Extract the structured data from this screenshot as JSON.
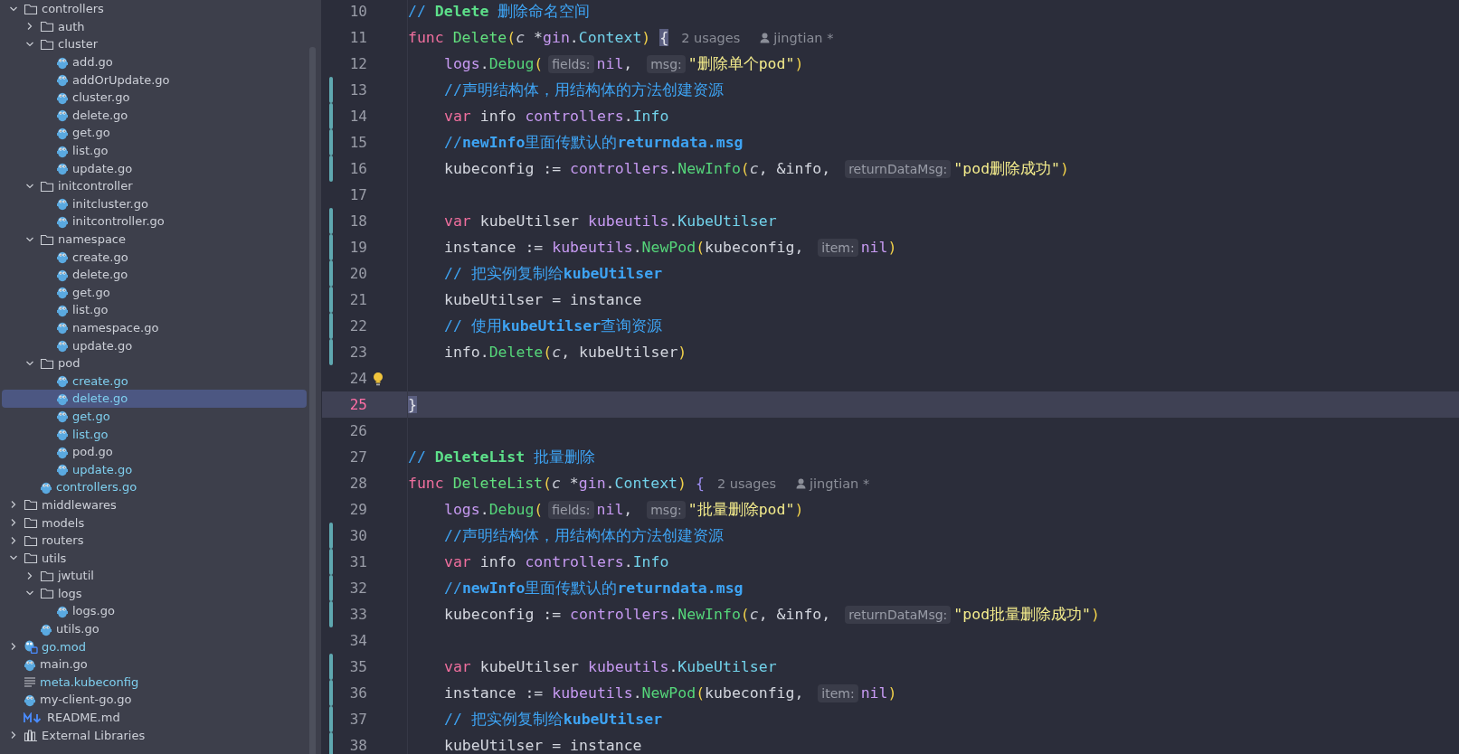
{
  "project_tree": [
    {
      "label": "controllers",
      "kind": "folder",
      "expanded": true,
      "children": [
        {
          "label": "auth",
          "kind": "folder",
          "expanded": false
        },
        {
          "label": "cluster",
          "kind": "folder",
          "expanded": true,
          "children": [
            {
              "label": "add.go",
              "kind": "go",
              "modified": false,
              "selected": false
            },
            {
              "label": "addOrUpdate.go",
              "kind": "go",
              "modified": false,
              "selected": false
            },
            {
              "label": "cluster.go",
              "kind": "go",
              "modified": false,
              "selected": false
            },
            {
              "label": "delete.go",
              "kind": "go",
              "modified": false,
              "selected": false
            },
            {
              "label": "get.go",
              "kind": "go",
              "modified": false,
              "selected": false
            },
            {
              "label": "list.go",
              "kind": "go",
              "modified": false,
              "selected": false
            },
            {
              "label": "update.go",
              "kind": "go",
              "modified": false,
              "selected": false
            }
          ]
        },
        {
          "label": "initcontroller",
          "kind": "folder",
          "expanded": true,
          "children": [
            {
              "label": "initcluster.go",
              "kind": "go",
              "modified": false,
              "selected": false
            },
            {
              "label": "initcontroller.go",
              "kind": "go",
              "modified": false,
              "selected": false
            }
          ]
        },
        {
          "label": "namespace",
          "kind": "folder",
          "expanded": true,
          "children": [
            {
              "label": "create.go",
              "kind": "go",
              "modified": false,
              "selected": false
            },
            {
              "label": "delete.go",
              "kind": "go",
              "modified": false,
              "selected": false
            },
            {
              "label": "get.go",
              "kind": "go",
              "modified": false,
              "selected": false
            },
            {
              "label": "list.go",
              "kind": "go",
              "modified": false,
              "selected": false
            },
            {
              "label": "namespace.go",
              "kind": "go",
              "modified": false,
              "selected": false
            },
            {
              "label": "update.go",
              "kind": "go",
              "modified": false,
              "selected": false
            }
          ]
        },
        {
          "label": "pod",
          "kind": "folder",
          "expanded": true,
          "children": [
            {
              "label": "create.go",
              "kind": "go",
              "modified": true,
              "selected": false
            },
            {
              "label": "delete.go",
              "kind": "go",
              "modified": true,
              "selected": true
            },
            {
              "label": "get.go",
              "kind": "go",
              "modified": true,
              "selected": false
            },
            {
              "label": "list.go",
              "kind": "go",
              "modified": true,
              "selected": false
            },
            {
              "label": "pod.go",
              "kind": "go",
              "modified": false,
              "selected": false
            },
            {
              "label": "update.go",
              "kind": "go",
              "modified": true,
              "selected": false
            }
          ]
        },
        {
          "label": "controllers.go",
          "kind": "go",
          "modified": true,
          "selected": false
        }
      ]
    },
    {
      "label": "middlewares",
      "kind": "folder",
      "expanded": false
    },
    {
      "label": "models",
      "kind": "folder",
      "expanded": false
    },
    {
      "label": "routers",
      "kind": "folder",
      "expanded": false
    },
    {
      "label": "utils",
      "kind": "folder",
      "expanded": true,
      "children": [
        {
          "label": "jwtutil",
          "kind": "folder",
          "expanded": false
        },
        {
          "label": "logs",
          "kind": "folder",
          "expanded": true,
          "children": [
            {
              "label": "logs.go",
              "kind": "go",
              "modified": false,
              "selected": false
            }
          ]
        },
        {
          "label": "utils.go",
          "kind": "go",
          "modified": false,
          "selected": false
        }
      ]
    },
    {
      "label": "go.mod",
      "kind": "module",
      "expanded": false,
      "modified": true,
      "selected": false
    },
    {
      "label": "main.go",
      "kind": "go",
      "modified": false,
      "selected": false
    },
    {
      "label": "meta.kubeconfig",
      "kind": "text",
      "modified": true,
      "selected": false
    },
    {
      "label": "my-client-go.go",
      "kind": "go",
      "modified": false,
      "selected": false
    },
    {
      "label": "README.md",
      "kind": "markdown",
      "modified": false,
      "selected": false
    },
    {
      "label": "External Libraries",
      "kind": "library",
      "expanded": false
    }
  ],
  "editor": {
    "lines": [
      {
        "number": "10",
        "changed": false,
        "current": false,
        "indented": false,
        "bulb": false,
        "tokens": [
          {
            "text": "// ",
            "kind": "cmt"
          },
          {
            "text": "Delete",
            "kind": "doc"
          },
          {
            "text": " 删除命名空间",
            "kind": "cmt"
          }
        ]
      },
      {
        "number": "11",
        "changed": false,
        "current": false,
        "indented": false,
        "bulb": false,
        "tokens": [
          {
            "text": "func ",
            "kind": "kw"
          },
          {
            "text": "Delete",
            "kind": "fn"
          },
          {
            "text": "(",
            "kind": "paren"
          },
          {
            "text": "c",
            "kind": "param"
          },
          {
            "text": " *",
            "kind": "plain"
          },
          {
            "text": "gin",
            "kind": "pkg"
          },
          {
            "text": ".",
            "kind": "plain"
          },
          {
            "text": "Context",
            "kind": "type"
          },
          {
            "text": ") ",
            "kind": "paren"
          },
          {
            "text": "{",
            "kind": "match"
          },
          {
            "text": "2 usages",
            "kind": "usages"
          },
          {
            "text": "jingtian *",
            "kind": "author"
          }
        ]
      },
      {
        "number": "12",
        "changed": false,
        "current": false,
        "indented": true,
        "bulb": false,
        "tokens": [
          {
            "text": "logs",
            "kind": "pkg"
          },
          {
            "text": ".",
            "kind": "plain"
          },
          {
            "text": "Debug",
            "kind": "call"
          },
          {
            "text": "(",
            "kind": "paren"
          },
          {
            "text": "fields:",
            "kind": "hint"
          },
          {
            "text": "nil",
            "kind": "nil"
          },
          {
            "text": ", ",
            "kind": "plain"
          },
          {
            "text": "msg:",
            "kind": "hint"
          },
          {
            "text": "\"删除单个pod\"",
            "kind": "str"
          },
          {
            "text": ")",
            "kind": "paren"
          }
        ]
      },
      {
        "number": "13",
        "changed": true,
        "current": false,
        "indented": true,
        "bulb": false,
        "tokens": [
          {
            "text": "//声明结构体，用结构体的方法创建资源",
            "kind": "cmt"
          }
        ]
      },
      {
        "number": "14",
        "changed": true,
        "current": false,
        "indented": true,
        "bulb": false,
        "tokens": [
          {
            "text": "var ",
            "kind": "kw"
          },
          {
            "text": "info ",
            "kind": "plain"
          },
          {
            "text": "controllers",
            "kind": "pkg"
          },
          {
            "text": ".",
            "kind": "plain"
          },
          {
            "text": "Info",
            "kind": "type"
          }
        ]
      },
      {
        "number": "15",
        "changed": true,
        "current": false,
        "indented": true,
        "bulb": false,
        "tokens": [
          {
            "text": "//",
            "kind": "cmt"
          },
          {
            "text": "newInfo",
            "kind": "cmtb"
          },
          {
            "text": "里面传默认的",
            "kind": "cmt"
          },
          {
            "text": "returndata.msg",
            "kind": "cmtb"
          }
        ]
      },
      {
        "number": "16",
        "changed": true,
        "current": false,
        "indented": true,
        "bulb": false,
        "tokens": [
          {
            "text": "kubeconfig := ",
            "kind": "plain"
          },
          {
            "text": "controllers",
            "kind": "pkg"
          },
          {
            "text": ".",
            "kind": "plain"
          },
          {
            "text": "NewInfo",
            "kind": "call"
          },
          {
            "text": "(",
            "kind": "paren"
          },
          {
            "text": "c",
            "kind": "param"
          },
          {
            "text": ", &info, ",
            "kind": "plain"
          },
          {
            "text": "returnDataMsg:",
            "kind": "hint"
          },
          {
            "text": "\"pod删除成功\"",
            "kind": "str"
          },
          {
            "text": ")",
            "kind": "paren"
          }
        ]
      },
      {
        "number": "17",
        "changed": false,
        "current": false,
        "indented": false,
        "bulb": false
      },
      {
        "number": "18",
        "changed": true,
        "current": false,
        "indented": true,
        "bulb": false,
        "tokens": [
          {
            "text": "var ",
            "kind": "kw"
          },
          {
            "text": "kubeUtilser ",
            "kind": "plain"
          },
          {
            "text": "kubeutils",
            "kind": "pkg"
          },
          {
            "text": ".",
            "kind": "plain"
          },
          {
            "text": "KubeUtilser",
            "kind": "type"
          }
        ]
      },
      {
        "number": "19",
        "changed": true,
        "current": false,
        "indented": true,
        "bulb": false,
        "tokens": [
          {
            "text": "instance := ",
            "kind": "plain"
          },
          {
            "text": "kubeutils",
            "kind": "pkg"
          },
          {
            "text": ".",
            "kind": "plain"
          },
          {
            "text": "NewPod",
            "kind": "call"
          },
          {
            "text": "(",
            "kind": "paren"
          },
          {
            "text": "kubeconfig, ",
            "kind": "plain"
          },
          {
            "text": "item:",
            "kind": "hint"
          },
          {
            "text": "nil",
            "kind": "nil"
          },
          {
            "text": ")",
            "kind": "paren"
          }
        ]
      },
      {
        "number": "20",
        "changed": true,
        "current": false,
        "indented": true,
        "bulb": false,
        "tokens": [
          {
            "text": "// 把实例复制给",
            "kind": "cmt"
          },
          {
            "text": "kubeUtilser",
            "kind": "cmtb"
          }
        ]
      },
      {
        "number": "21",
        "changed": true,
        "current": false,
        "indented": true,
        "bulb": false,
        "tokens": [
          {
            "text": "kubeUtilser = instance",
            "kind": "plain"
          }
        ]
      },
      {
        "number": "22",
        "changed": true,
        "current": false,
        "indented": true,
        "bulb": false,
        "tokens": [
          {
            "text": "// 使用",
            "kind": "cmt"
          },
          {
            "text": "kubeUtilser",
            "kind": "cmtb"
          },
          {
            "text": "查询资源",
            "kind": "cmt"
          }
        ]
      },
      {
        "number": "23",
        "changed": true,
        "current": false,
        "indented": true,
        "bulb": false,
        "tokens": [
          {
            "text": "info",
            "kind": "plain"
          },
          {
            "text": ".",
            "kind": "plain"
          },
          {
            "text": "Delete",
            "kind": "call"
          },
          {
            "text": "(",
            "kind": "paren"
          },
          {
            "text": "c",
            "kind": "param"
          },
          {
            "text": ", kubeUtilser",
            "kind": "plain"
          },
          {
            "text": ")",
            "kind": "paren"
          }
        ]
      },
      {
        "number": "24",
        "changed": false,
        "current": false,
        "indented": false,
        "bulb": true
      },
      {
        "number": "25",
        "changed": false,
        "current": true,
        "indented": false,
        "bulb": false,
        "tokens": [
          {
            "text": "}",
            "kind": "match"
          }
        ]
      },
      {
        "number": "26",
        "changed": false,
        "current": false,
        "indented": false,
        "bulb": false
      },
      {
        "number": "27",
        "changed": false,
        "current": false,
        "indented": false,
        "bulb": false,
        "tokens": [
          {
            "text": "// ",
            "kind": "cmt"
          },
          {
            "text": "DeleteList",
            "kind": "doc"
          },
          {
            "text": " 批量删除",
            "kind": "cmt"
          }
        ]
      },
      {
        "number": "28",
        "changed": false,
        "current": false,
        "indented": false,
        "bulb": false,
        "tokens": [
          {
            "text": "func ",
            "kind": "kw"
          },
          {
            "text": "DeleteList",
            "kind": "fn"
          },
          {
            "text": "(",
            "kind": "paren"
          },
          {
            "text": "c",
            "kind": "param"
          },
          {
            "text": " *",
            "kind": "plain"
          },
          {
            "text": "gin",
            "kind": "pkg"
          },
          {
            "text": ".",
            "kind": "plain"
          },
          {
            "text": "Context",
            "kind": "type"
          },
          {
            "text": ") ",
            "kind": "paren"
          },
          {
            "text": "{",
            "kind": "brace"
          },
          {
            "text": "2 usages",
            "kind": "usages"
          },
          {
            "text": "jingtian *",
            "kind": "author"
          }
        ]
      },
      {
        "number": "29",
        "changed": false,
        "current": false,
        "indented": true,
        "bulb": false,
        "tokens": [
          {
            "text": "logs",
            "kind": "pkg"
          },
          {
            "text": ".",
            "kind": "plain"
          },
          {
            "text": "Debug",
            "kind": "call"
          },
          {
            "text": "(",
            "kind": "paren"
          },
          {
            "text": "fields:",
            "kind": "hint"
          },
          {
            "text": "nil",
            "kind": "nil"
          },
          {
            "text": ", ",
            "kind": "plain"
          },
          {
            "text": "msg:",
            "kind": "hint"
          },
          {
            "text": "\"批量删除pod\"",
            "kind": "str"
          },
          {
            "text": ")",
            "kind": "paren"
          }
        ]
      },
      {
        "number": "30",
        "changed": true,
        "current": false,
        "indented": true,
        "bulb": false,
        "tokens": [
          {
            "text": "//声明结构体，用结构体的方法创建资源",
            "kind": "cmt"
          }
        ]
      },
      {
        "number": "31",
        "changed": true,
        "current": false,
        "indented": true,
        "bulb": false,
        "tokens": [
          {
            "text": "var ",
            "kind": "kw"
          },
          {
            "text": "info ",
            "kind": "plain"
          },
          {
            "text": "controllers",
            "kind": "pkg"
          },
          {
            "text": ".",
            "kind": "plain"
          },
          {
            "text": "Info",
            "kind": "type"
          }
        ]
      },
      {
        "number": "32",
        "changed": true,
        "current": false,
        "indented": true,
        "bulb": false,
        "tokens": [
          {
            "text": "//",
            "kind": "cmt"
          },
          {
            "text": "newInfo",
            "kind": "cmtb"
          },
          {
            "text": "里面传默认的",
            "kind": "cmt"
          },
          {
            "text": "returndata.msg",
            "kind": "cmtb"
          }
        ]
      },
      {
        "number": "33",
        "changed": true,
        "current": false,
        "indented": true,
        "bulb": false,
        "tokens": [
          {
            "text": "kubeconfig := ",
            "kind": "plain"
          },
          {
            "text": "controllers",
            "kind": "pkg"
          },
          {
            "text": ".",
            "kind": "plain"
          },
          {
            "text": "NewInfo",
            "kind": "call"
          },
          {
            "text": "(",
            "kind": "paren"
          },
          {
            "text": "c",
            "kind": "param"
          },
          {
            "text": ", &info, ",
            "kind": "plain"
          },
          {
            "text": "returnDataMsg:",
            "kind": "hint"
          },
          {
            "text": "\"pod批量删除成功\"",
            "kind": "str"
          },
          {
            "text": ")",
            "kind": "paren"
          }
        ]
      },
      {
        "number": "34",
        "changed": false,
        "current": false,
        "indented": false,
        "bulb": false
      },
      {
        "number": "35",
        "changed": true,
        "current": false,
        "indented": true,
        "bulb": false,
        "tokens": [
          {
            "text": "var ",
            "kind": "kw"
          },
          {
            "text": "kubeUtilser ",
            "kind": "plain"
          },
          {
            "text": "kubeutils",
            "kind": "pkg"
          },
          {
            "text": ".",
            "kind": "plain"
          },
          {
            "text": "KubeUtilser",
            "kind": "type"
          }
        ]
      },
      {
        "number": "36",
        "changed": true,
        "current": false,
        "indented": true,
        "bulb": false,
        "tokens": [
          {
            "text": "instance := ",
            "kind": "plain"
          },
          {
            "text": "kubeutils",
            "kind": "pkg"
          },
          {
            "text": ".",
            "kind": "plain"
          },
          {
            "text": "NewPod",
            "kind": "call"
          },
          {
            "text": "(",
            "kind": "paren"
          },
          {
            "text": "kubeconfig, ",
            "kind": "plain"
          },
          {
            "text": "item:",
            "kind": "hint"
          },
          {
            "text": "nil",
            "kind": "nil"
          },
          {
            "text": ")",
            "kind": "paren"
          }
        ]
      },
      {
        "number": "37",
        "changed": true,
        "current": false,
        "indented": true,
        "bulb": false,
        "tokens": [
          {
            "text": "// 把实例复制给",
            "kind": "cmt"
          },
          {
            "text": "kubeUtilser",
            "kind": "cmtb"
          }
        ]
      },
      {
        "number": "38",
        "changed": true,
        "current": false,
        "indented": true,
        "bulb": false,
        "tokens": [
          {
            "text": "kubeUtilser = instance",
            "kind": "plain"
          }
        ]
      }
    ]
  }
}
